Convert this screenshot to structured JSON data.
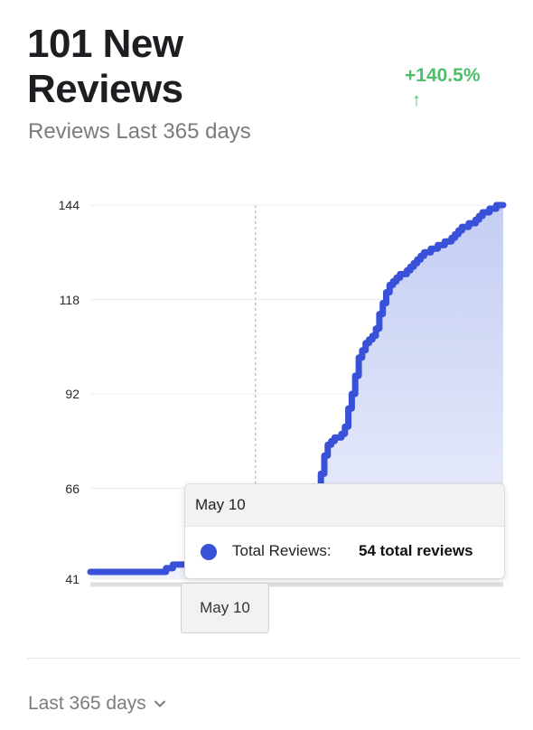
{
  "header": {
    "title": "101 New Reviews",
    "delta": "+140.5%",
    "delta_arrow": "↑",
    "subtitle": "Reviews Last 365 days"
  },
  "colors": {
    "line": "#3950d8",
    "fill_top": "#c4cdf3",
    "fill_bottom": "#eef1fc",
    "positive": "#4cbf6a"
  },
  "chart_data": {
    "type": "area",
    "ylim": [
      41,
      144
    ],
    "yticks": [
      41,
      66,
      92,
      118,
      144
    ],
    "series": [
      {
        "values": [
          43,
          43,
          43,
          43,
          43,
          43,
          43,
          43,
          43,
          43,
          43,
          43,
          43,
          43,
          43,
          43,
          43,
          43,
          43,
          43,
          43,
          43,
          44,
          44,
          45,
          45,
          45,
          45,
          45,
          45,
          45,
          45,
          45,
          45,
          46,
          46,
          46,
          47,
          47,
          48,
          50,
          50,
          51,
          51,
          52,
          53,
          54,
          54,
          54,
          54,
          54,
          54,
          54,
          54,
          54,
          54,
          54,
          54,
          54,
          54,
          54,
          54,
          54,
          55,
          55,
          56,
          66,
          70,
          75,
          78,
          79,
          80,
          80,
          81,
          83,
          88,
          92,
          97,
          102,
          104,
          106,
          107,
          108,
          110,
          114,
          117,
          120,
          122,
          123,
          124,
          125,
          125,
          126,
          127,
          128,
          129,
          130,
          131,
          131,
          132,
          132,
          133,
          133,
          134,
          134,
          135,
          136,
          137,
          138,
          138,
          139,
          139,
          140,
          141,
          142,
          142,
          143,
          143,
          144,
          144,
          144
        ]
      }
    ],
    "hover_index": 48,
    "tooltip": {
      "date": "May 10",
      "label": "Total Reviews:",
      "value": "54 total reviews"
    }
  },
  "footer": {
    "range_label": "Last 365 days"
  }
}
